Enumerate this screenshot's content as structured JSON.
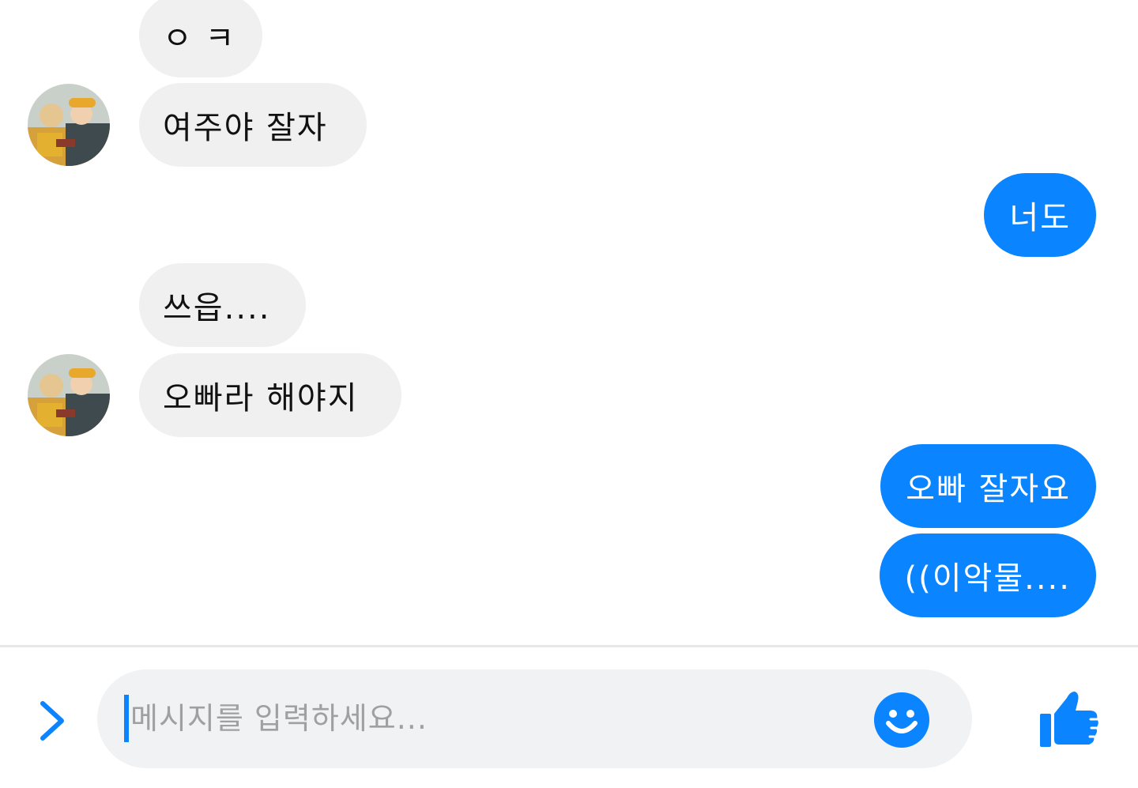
{
  "conversation": {
    "messages": [
      {
        "direction": "incoming",
        "text": "ㅇ ㅋ"
      },
      {
        "direction": "incoming",
        "text": "여주야 잘자",
        "avatar": "contact-avatar"
      },
      {
        "direction": "outgoing",
        "text": "너도"
      },
      {
        "direction": "incoming",
        "text": "쓰읍...."
      },
      {
        "direction": "incoming",
        "text": "오빠라 해야지",
        "avatar": "contact-avatar"
      },
      {
        "direction": "outgoing",
        "text": "오빠 잘자요"
      },
      {
        "direction": "outgoing",
        "text": "((이악물...."
      }
    ]
  },
  "composer": {
    "placeholder": "메시지를 입력하세요...",
    "icons": {
      "expand": "chevron-right-icon",
      "emoji": "smiley-icon",
      "like": "thumbs-up-icon"
    }
  },
  "colors": {
    "accent": "#0a84ff",
    "incoming_bubble": "#f0f0f0",
    "outgoing_text": "#ffffff",
    "input_background": "#f1f2f4",
    "placeholder_text": "#a0a0a0"
  }
}
